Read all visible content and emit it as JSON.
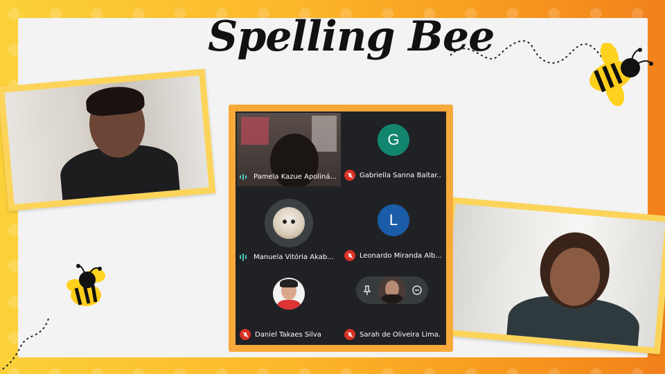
{
  "slide": {
    "title": "Spelling Bee"
  },
  "meet": {
    "participants": [
      {
        "name": "Pamela Kazue Apoliná...",
        "muted": false,
        "speaking": true,
        "avatar_type": "video"
      },
      {
        "name": "Gabriella Sanna Baltar...",
        "muted": true,
        "avatar_letter": "G",
        "avatar_color": "#12856f"
      },
      {
        "name": "Manuela Vitória Akab...",
        "muted": false,
        "speaking": true,
        "avatar_type": "photo-dog"
      },
      {
        "name": "Leonardo Miranda Alb...",
        "muted": true,
        "avatar_letter": "L",
        "avatar_color": "#1a5ca8"
      },
      {
        "name": "Daniel Takaes Silva",
        "muted": true,
        "avatar_type": "photo"
      },
      {
        "name": "Sarah de Oliveira Lima...",
        "muted": true,
        "avatar_type": "photo"
      }
    ],
    "hover_controls": [
      "pin-icon",
      "remove-icon"
    ]
  },
  "colors": {
    "frame": "#f7a93a",
    "photo_border": "#fcd45a",
    "meet_bg": "#202124",
    "muted": "#d93025"
  }
}
